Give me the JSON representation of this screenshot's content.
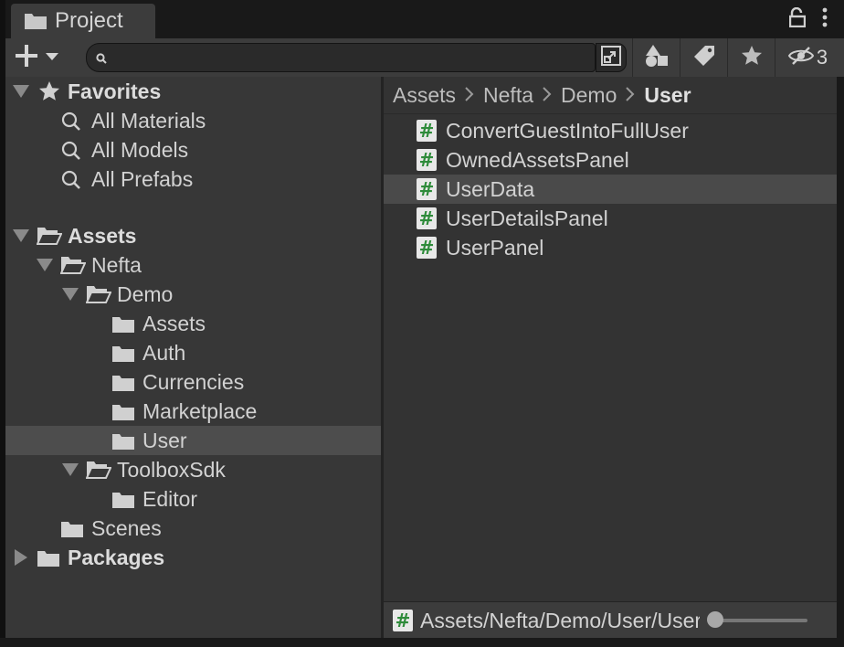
{
  "window": {
    "tab_title": "Project",
    "hidden_count": "3"
  },
  "search": {
    "placeholder": "",
    "value": ""
  },
  "tree": {
    "favorites": {
      "label": "Favorites",
      "items": [
        "All Materials",
        "All Models",
        "All Prefabs"
      ]
    },
    "assets": {
      "label": "Assets",
      "nefta": "Nefta",
      "demo": "Demo",
      "demo_children": [
        "Assets",
        "Auth",
        "Currencies",
        "Marketplace",
        "User"
      ],
      "selected": "User",
      "toolbox": "ToolboxSdk",
      "toolbox_children": [
        "Editor"
      ],
      "scenes": "Scenes"
    },
    "packages": {
      "label": "Packages"
    }
  },
  "breadcrumb": {
    "parts": [
      "Assets",
      "Nefta",
      "Demo"
    ],
    "current": "User"
  },
  "files": {
    "items": [
      "ConvertGuestIntoFullUser",
      "OwnedAssetsPanel",
      "UserData",
      "UserDetailsPanel",
      "UserPanel"
    ],
    "selected": "UserData"
  },
  "status": {
    "path": "Assets/Nefta/Demo/User/UserData.cs"
  },
  "zoom_slider": {
    "value": 0
  },
  "icons": {
    "create": "plus-icon",
    "dropdown": "caret-down-icon",
    "search": "search-icon",
    "lock": "lock-icon",
    "menu": "kebab-menu-icon",
    "by_type": "type-filter-icon",
    "by_label": "label-tag-icon",
    "favorite": "star-icon",
    "hidden": "eye-slash-icon",
    "script": "csharp-script-icon",
    "folder": "folder-icon"
  },
  "colors": {
    "background": "#191919",
    "panel": "#373737",
    "selection": "#4d4d4d",
    "script_hash": "#2e8b3a"
  }
}
